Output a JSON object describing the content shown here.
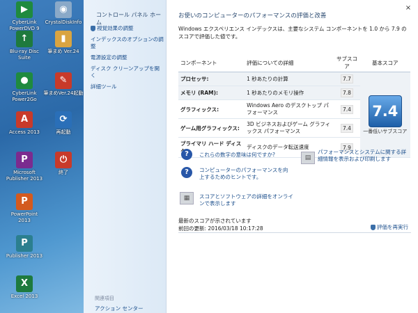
{
  "desktop": {
    "icons": [
      {
        "label": "CyberLink PowerDVD 9",
        "glyph": "▶",
        "cls": "g-cyber"
      },
      {
        "label": "CrystalDiskInfo",
        "glyph": "◉",
        "cls": "g-crystal"
      },
      {
        "label": "Blu-ray Disc Suite",
        "glyph": "↑",
        "cls": "g-green"
      },
      {
        "label": "筆まめ Ver.24",
        "glyph": "▮",
        "cls": "g-folder"
      },
      {
        "label": "CyberLink Power2Go",
        "glyph": "●",
        "cls": "g-cyber"
      },
      {
        "label": "筆まめVer.24起動",
        "glyph": "✎",
        "cls": "g-red"
      },
      {
        "label": "Access 2013",
        "glyph": "A",
        "cls": "g-red"
      },
      {
        "label": "再起動",
        "glyph": "⟳",
        "cls": "g-round"
      },
      {
        "label": "Microsoft Publisher 2013",
        "glyph": "P",
        "cls": "g-purple"
      },
      {
        "label": "終了",
        "glyph": "⏻",
        "cls": "g-red"
      },
      {
        "label": "PowerPoint 2013",
        "glyph": "P",
        "cls": "g-orange"
      },
      {
        "label": "Publisher 2013",
        "glyph": "P",
        "cls": "g-teal"
      },
      {
        "label": "Excel 2013",
        "glyph": "X",
        "cls": "g-green"
      }
    ]
  },
  "nav": {
    "home": "コントロール パネル ホーム",
    "items": [
      "視覚効果の調整",
      "インデックスのオプションの調整",
      "電源設定の調整",
      "ディスク クリーンアップを開く",
      "詳細ツール"
    ],
    "see_also": "関連項目",
    "action_center": "アクション センター"
  },
  "main": {
    "title": "お使いのコンピューターのパフォーマンスの評価と改善",
    "intro": "Windows エクスペリエンス インデックスは、主要なシステム コンポーネントを 1.0 から 7.9 のスコアで評価した値です。",
    "headers": {
      "component": "コンポーネント",
      "detail": "評価についての詳細",
      "subscore": "サブスコア",
      "base": "基本スコア"
    },
    "rows": [
      {
        "component": "プロセッサ:",
        "detail": "1 秒あたりの計算",
        "score": "7.7"
      },
      {
        "component": "メモリ (RAM):",
        "detail": "1 秒あたりのメモリ操作",
        "score": "7.8"
      },
      {
        "component": "グラフィックス:",
        "detail": "Windows Aero のデスクトップ パフォーマンス",
        "score": "7.4"
      },
      {
        "component": "ゲーム用グラフィックス:",
        "detail": "3D ビジネスおよびゲーム グラフィックス パフォーマンス",
        "score": "7.4"
      },
      {
        "component": "プライマリ ハード ディスク:",
        "detail": "ディスクのデータ転送速度",
        "score": "7.9"
      }
    ],
    "base_score": "7.4",
    "base_caption": "一番低いサブスコア",
    "help": [
      {
        "text": "これらの数字の意味は何ですか?"
      },
      {
        "text": "パフォーマンスとシステムに関する詳細情報を表示および印刷します"
      },
      {
        "text": "コンピューターのパフォーマンスを向上するためのヒントです。"
      },
      {
        "text": "スコアとソフトウェアの詳細をオンラインで表示します"
      }
    ],
    "status_line1": "最新のスコアが示されています",
    "status_line2": "前回の更新: 2016/03/18 10:17:28",
    "rerun": "評価を再実行",
    "close_glyph": "×"
  }
}
